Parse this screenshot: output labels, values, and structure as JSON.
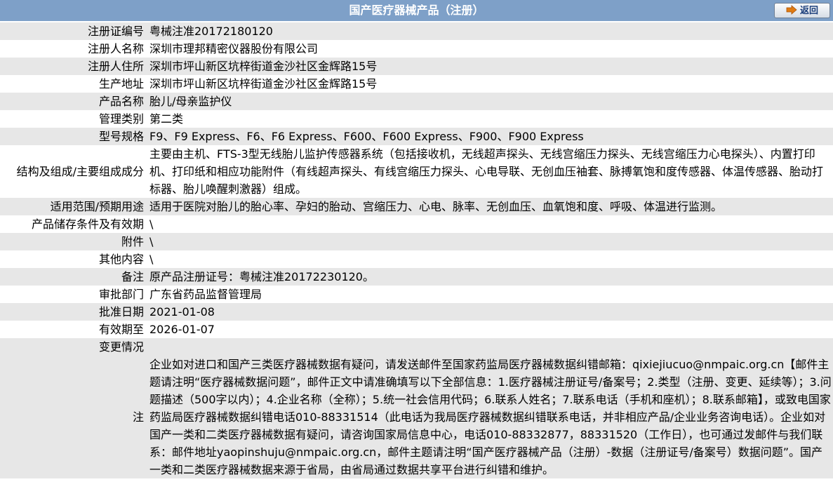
{
  "header": {
    "title": "国产医疗器械产品（注册）",
    "back_label": "返回"
  },
  "rows": [
    {
      "label": "注册证编号",
      "value": "粤械注准20172180120"
    },
    {
      "label": "注册人名称",
      "value": "深圳市理邦精密仪器股份有限公司"
    },
    {
      "label": "注册人住所",
      "value": "深圳市坪山新区坑梓街道金沙社区金辉路15号"
    },
    {
      "label": "生产地址",
      "value": "深圳市坪山新区坑梓街道金沙社区金辉路15号"
    },
    {
      "label": "产品名称",
      "value": "胎儿/母亲监护仪"
    },
    {
      "label": "管理类别",
      "value": "第二类"
    },
    {
      "label": "型号规格",
      "value": "F9、F9 Express、F6、F6 Express、F600、F600 Express、F900、F900 Express"
    },
    {
      "label": "结构及组成/主要组成成分",
      "value": "主要由主机、FTS-3型无线胎儿监护传感器系统（包括接收机，无线超声探头、无线宫缩压力探头、无线宫缩压力心电探头）、内置打印机、打印纸和相应功能附件（有线超声探头、有线宫缩压力探头、心电导联、无创血压袖套、脉搏氧饱和度传感器、体温传感器、胎动打标器、胎儿唤醒刺激器）组成。"
    },
    {
      "label": "适用范围/预期用途",
      "value": "适用于医院对胎儿的胎心率、孕妇的胎动、宫缩压力、心电、脉率、无创血压、血氧饱和度、呼吸、体温进行监测。"
    },
    {
      "label": "产品储存条件及有效期",
      "value": "\\"
    },
    {
      "label": "附件",
      "value": "\\"
    },
    {
      "label": "其他内容",
      "value": "\\"
    },
    {
      "label": "备注",
      "value": "原产品注册证号：粤械注准20172230120。"
    },
    {
      "label": "审批部门",
      "value": "广东省药品监督管理局"
    },
    {
      "label": "批准日期",
      "value": "2021-01-08"
    },
    {
      "label": "有效期至",
      "value": "2026-01-07"
    },
    {
      "label": "变更情况",
      "value": ""
    }
  ],
  "note": {
    "label": "注",
    "text": "企业如对进口和国产三类医疗器械数据有疑问，请发送邮件至国家药监局医疗器械数据纠错邮箱：qixiejiucuo@nmpaic.org.cn【邮件主题请注明“医疗器械数据问题”，邮件正文中请准确填写以下全部信息：1.医疗器械注册证号/备案号；2.类型（注册、变更、延续等）；3.问题描述（500字以内）；4.企业名称（全称）；5.统一社会信用代码；6.联系人姓名；7.联系电话（手机和座机）；8.联系邮箱】，或致电国家药监局医疗器械数据纠错电话010-88331514（此电话为我局医疗器械数据纠错联系电话，并非相应产品/企业业务咨询电话）。企业如对国产一类和二类医疗器械数据有疑问，请咨询国家局信息中心，电话010-88332877，88331520（工作日），也可通过发邮件与我们联系：邮件地址yaopinshuju@nmpaic.org.cn，邮件主题请注明“国产医疗器械产品（注册）-数据（注册证号/备案号）数据问题”。国产一类和二类医疗器械数据来源于省局，由省局通过数据共享平台进行纠错和维护。"
  },
  "colors": {
    "header_bg": "#7ea0c8",
    "row_odd": "#e7e7e7",
    "row_even": "#ffffff",
    "back_text": "#1a3d7a"
  },
  "icons": {
    "back": "arrow-right-icon"
  }
}
